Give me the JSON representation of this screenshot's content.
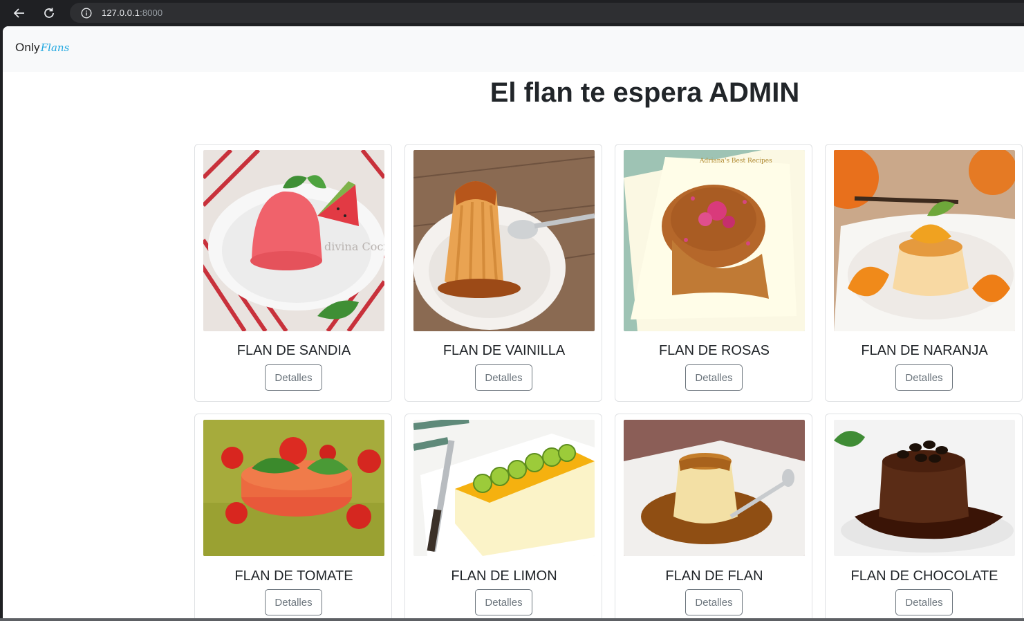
{
  "browser": {
    "url_host": "127.0.0.1",
    "url_port": ":8000"
  },
  "navbar": {
    "brand_only": "Only",
    "brand_flans": "Flans"
  },
  "page": {
    "title": "El flan te espera ADMIN"
  },
  "flans": [
    {
      "name": "FLAN DE SANDIA",
      "button": "Detalles",
      "watermark": "divina Cocina"
    },
    {
      "name": "FLAN DE VAINILLA",
      "button": "Detalles"
    },
    {
      "name": "FLAN DE ROSAS",
      "button": "Detalles",
      "watermark": "Adriana's Best Recipes"
    },
    {
      "name": "FLAN DE NARANJA",
      "button": "Detalles"
    },
    {
      "name": "FLAN DE TOMATE",
      "button": "Detalles"
    },
    {
      "name": "FLAN DE LIMON",
      "button": "Detalles"
    },
    {
      "name": "FLAN DE FLAN",
      "button": "Detalles"
    },
    {
      "name": "FLAN DE CHOCOLATE",
      "button": "Detalles"
    }
  ]
}
